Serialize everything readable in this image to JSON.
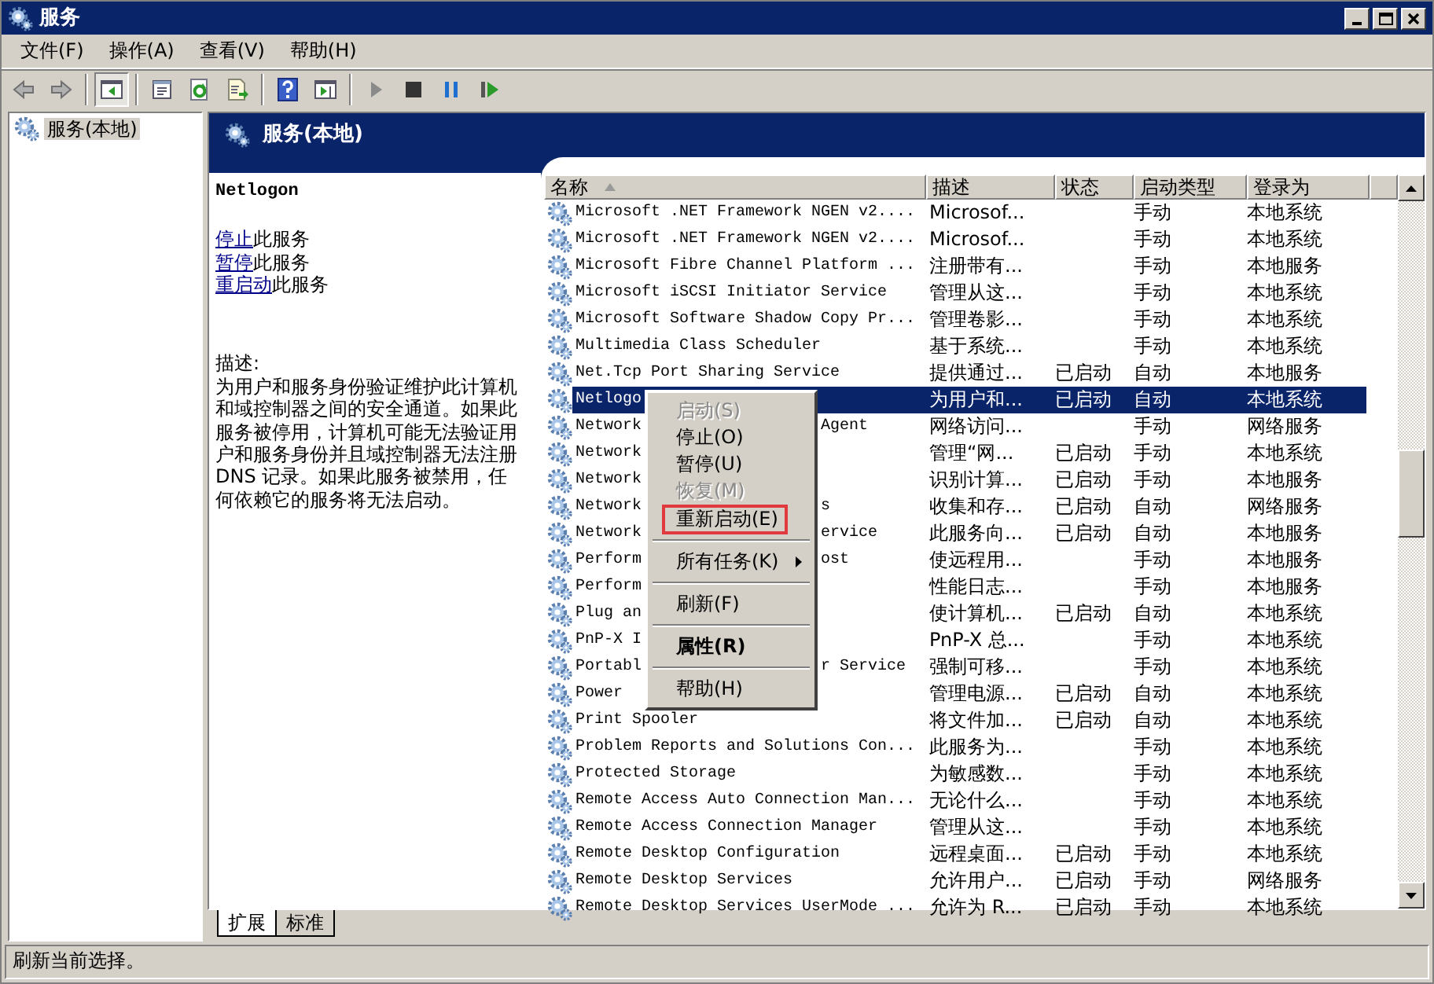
{
  "window": {
    "title": "服务"
  },
  "menu_bar": [
    "文件(F)",
    "操作(A)",
    "查看(V)",
    "帮助(H)"
  ],
  "toolbar": [
    {
      "kind": "back"
    },
    {
      "kind": "forward"
    },
    {
      "kind": "separator"
    },
    {
      "kind": "console-tree",
      "pressed": true
    },
    {
      "kind": "separator"
    },
    {
      "kind": "properties",
      "pressed": false
    },
    {
      "kind": "refresh",
      "pressed": false
    },
    {
      "kind": "export",
      "pressed": false
    },
    {
      "kind": "separator"
    },
    {
      "kind": "help",
      "pressed": false
    },
    {
      "kind": "action-pane",
      "pressed": false
    },
    {
      "kind": "separator"
    },
    {
      "kind": "start",
      "pressed": false
    },
    {
      "kind": "stop",
      "pressed": false
    },
    {
      "kind": "pause",
      "pressed": false
    },
    {
      "kind": "restart",
      "pressed": false
    }
  ],
  "tree": [
    {
      "label": "服务(本地)",
      "selected": true
    }
  ],
  "panel": {
    "title": "服务(本地)",
    "detail": {
      "service_name": "Netlogon",
      "actions": [
        {
          "link": "停止",
          "text": "此服务"
        },
        {
          "link": "暂停",
          "text": "此服务"
        },
        {
          "link": "重启动",
          "text": "此服务"
        }
      ],
      "description_label": "描述:",
      "description": "为用户和服务身份验证维护此计算机和域控制器之间的安全通道。如果此服务被停用，计算机可能无法验证用户和服务身份并且域控制器无法注册 DNS 记录。如果此服务被禁用，任何依赖它的服务将无法启动。"
    },
    "table": {
      "columns": [
        {
          "label": "名称",
          "sorted": true
        },
        {
          "label": "描述",
          "sorted": false
        },
        {
          "label": "状态",
          "sorted": false
        },
        {
          "label": "启动类型",
          "sorted": false
        },
        {
          "label": "登录为",
          "sorted": false
        }
      ],
      "rows": [
        {
          "name": "Microsoft .NET Framework NGEN v2....",
          "description": "Microsof...",
          "status": "",
          "startup": "手动",
          "logon": "本地系统",
          "selected": false
        },
        {
          "name": "Microsoft .NET Framework NGEN v2....",
          "description": "Microsof...",
          "status": "",
          "startup": "手动",
          "logon": "本地系统",
          "selected": false
        },
        {
          "name": "Microsoft Fibre Channel Platform ...",
          "description": "注册带有...",
          "status": "",
          "startup": "手动",
          "logon": "本地服务",
          "selected": false
        },
        {
          "name": "Microsoft iSCSI Initiator Service",
          "description": "管理从这...",
          "status": "",
          "startup": "手动",
          "logon": "本地系统",
          "selected": false
        },
        {
          "name": "Microsoft Software Shadow Copy Pr...",
          "description": "管理卷影...",
          "status": "",
          "startup": "手动",
          "logon": "本地系统",
          "selected": false
        },
        {
          "name": "Multimedia Class Scheduler",
          "description": "基于系统...",
          "status": "",
          "startup": "手动",
          "logon": "本地系统",
          "selected": false
        },
        {
          "name": "Net.Tcp Port Sharing Service",
          "description": "提供通过...",
          "status": "已启动",
          "startup": "自动",
          "logon": "本地服务",
          "selected": false
        },
        {
          "name": "Netlogo",
          "description": "为用户和...",
          "status": "已启动",
          "startup": "自动",
          "logon": "本地系统",
          "selected": true
        },
        {
          "name": "Network",
          "name_end": "Agent",
          "description": "网络访问...",
          "status": "",
          "startup": "手动",
          "logon": "网络服务",
          "selected": false
        },
        {
          "name": "Network",
          "description": "管理“网...",
          "status": "已启动",
          "startup": "手动",
          "logon": "本地系统",
          "selected": false
        },
        {
          "name": "Network",
          "description": "识别计算...",
          "status": "已启动",
          "startup": "手动",
          "logon": "本地服务",
          "selected": false
        },
        {
          "name": "Network",
          "name_end": "s",
          "description": "收集和存...",
          "status": "已启动",
          "startup": "自动",
          "logon": "网络服务",
          "selected": false
        },
        {
          "name": "Network",
          "name_end": "ervice",
          "description": "此服务向...",
          "status": "已启动",
          "startup": "自动",
          "logon": "本地服务",
          "selected": false
        },
        {
          "name": "Perform",
          "name_end": "ost",
          "description": "使远程用...",
          "status": "",
          "startup": "手动",
          "logon": "本地服务",
          "selected": false
        },
        {
          "name": "Perform",
          "description": "性能日志...",
          "status": "",
          "startup": "手动",
          "logon": "本地服务",
          "selected": false
        },
        {
          "name": "Plug an",
          "description": "使计算机...",
          "status": "已启动",
          "startup": "自动",
          "logon": "本地系统",
          "selected": false
        },
        {
          "name": "PnP-X I",
          "description": "PnP-X 总...",
          "status": "",
          "startup": "手动",
          "logon": "本地系统",
          "selected": false
        },
        {
          "name": "Portabl",
          "name_end": "r Service",
          "description": "强制可移...",
          "status": "",
          "startup": "手动",
          "logon": "本地系统",
          "selected": false
        },
        {
          "name": "Power",
          "description": "管理电源...",
          "status": "已启动",
          "startup": "自动",
          "logon": "本地系统",
          "selected": false
        },
        {
          "name": "Print Spooler",
          "description": "将文件加...",
          "status": "已启动",
          "startup": "自动",
          "logon": "本地系统",
          "selected": false
        },
        {
          "name": "Problem Reports and Solutions Con...",
          "description": "此服务为...",
          "status": "",
          "startup": "手动",
          "logon": "本地系统",
          "selected": false
        },
        {
          "name": "Protected Storage",
          "description": "为敏感数...",
          "status": "",
          "startup": "手动",
          "logon": "本地系统",
          "selected": false
        },
        {
          "name": "Remote Access Auto Connection Man...",
          "description": "无论什么...",
          "status": "",
          "startup": "手动",
          "logon": "本地系统",
          "selected": false
        },
        {
          "name": "Remote Access Connection Manager",
          "description": "管理从这...",
          "status": "",
          "startup": "手动",
          "logon": "本地系统",
          "selected": false
        },
        {
          "name": "Remote Desktop Configuration",
          "description": "远程桌面...",
          "status": "已启动",
          "startup": "手动",
          "logon": "本地系统",
          "selected": false
        },
        {
          "name": "Remote Desktop Services",
          "description": "允许用户...",
          "status": "已启动",
          "startup": "手动",
          "logon": "网络服务",
          "selected": false
        },
        {
          "name": "Remote Desktop Services UserMode ...",
          "description": "允许为 R...",
          "status": "已启动",
          "startup": "手动",
          "logon": "本地系统",
          "selected": false
        }
      ]
    },
    "view_tabs": [
      {
        "label": "扩展",
        "selected": true
      },
      {
        "label": "标准",
        "selected": false
      }
    ]
  },
  "context_menu": [
    {
      "kind": "item",
      "label": "启动(S)",
      "disabled": true,
      "outlined": false,
      "bold": false,
      "submenu": false
    },
    {
      "kind": "item",
      "label": "停止(O)",
      "disabled": false,
      "outlined": false,
      "bold": false,
      "submenu": false
    },
    {
      "kind": "item",
      "label": "暂停(U)",
      "disabled": false,
      "outlined": false,
      "bold": false,
      "submenu": false
    },
    {
      "kind": "item",
      "label": "恢复(M)",
      "disabled": true,
      "outlined": false,
      "bold": false,
      "submenu": false
    },
    {
      "kind": "item",
      "label": "重新启动(E)",
      "disabled": false,
      "outlined": true,
      "bold": false,
      "submenu": false
    },
    {
      "kind": "separator"
    },
    {
      "kind": "item",
      "label": "所有任务(K)",
      "disabled": false,
      "outlined": false,
      "bold": false,
      "submenu": true
    },
    {
      "kind": "separator"
    },
    {
      "kind": "item",
      "label": "刷新(F)",
      "disabled": false,
      "outlined": false,
      "bold": false,
      "submenu": false
    },
    {
      "kind": "separator"
    },
    {
      "kind": "item",
      "label": "属性(R)",
      "disabled": false,
      "outlined": false,
      "bold": true,
      "submenu": false
    },
    {
      "kind": "separator"
    },
    {
      "kind": "item",
      "label": "帮助(H)",
      "disabled": false,
      "outlined": false,
      "bold": false,
      "submenu": false
    }
  ],
  "status_bar": "刷新当前选择。"
}
